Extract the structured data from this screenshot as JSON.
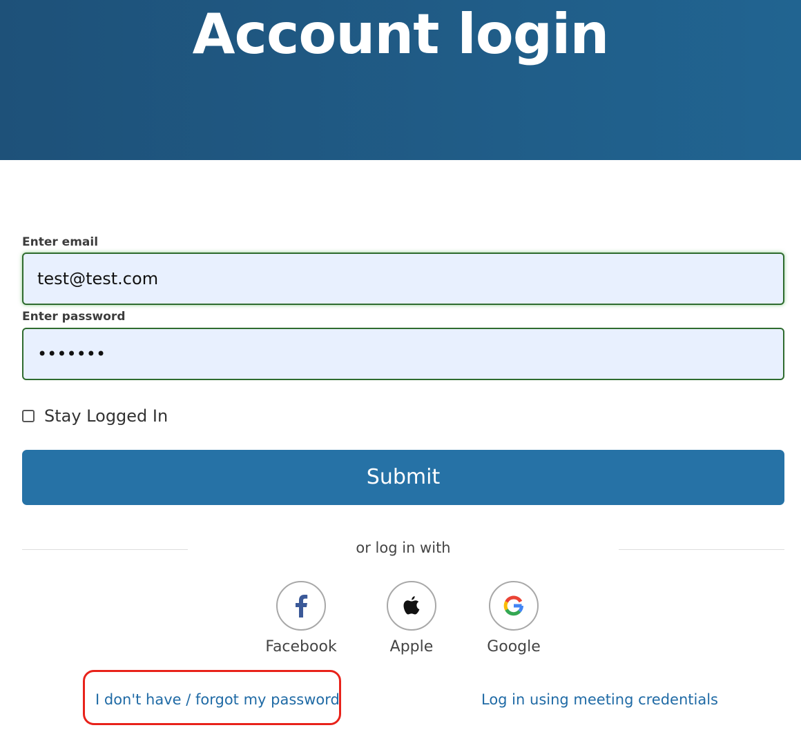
{
  "header": {
    "title": "Account login",
    "background": "#1e5179"
  },
  "form": {
    "email_label": "Enter email",
    "email_value": "test@test.com",
    "password_label": "Enter password",
    "password_value": "•••••••",
    "remember_label": "Stay Logged In",
    "remember_checked": false,
    "submit_label": "Submit",
    "submit_color": "#2672a6",
    "input_background": "#e8f0fe",
    "input_border": "#2e6b2e"
  },
  "social": {
    "divider_text": "or log in with",
    "providers": [
      {
        "label": "Facebook",
        "icon": "facebook-icon"
      },
      {
        "label": "Apple",
        "icon": "apple-icon"
      },
      {
        "label": "Google",
        "icon": "google-icon"
      }
    ]
  },
  "links": {
    "forgot_password": "I don't have / forgot my password",
    "meeting_credentials": "Log in using meeting credentials",
    "link_color": "#1f6aa5",
    "highlight_color": "#e8221a"
  }
}
